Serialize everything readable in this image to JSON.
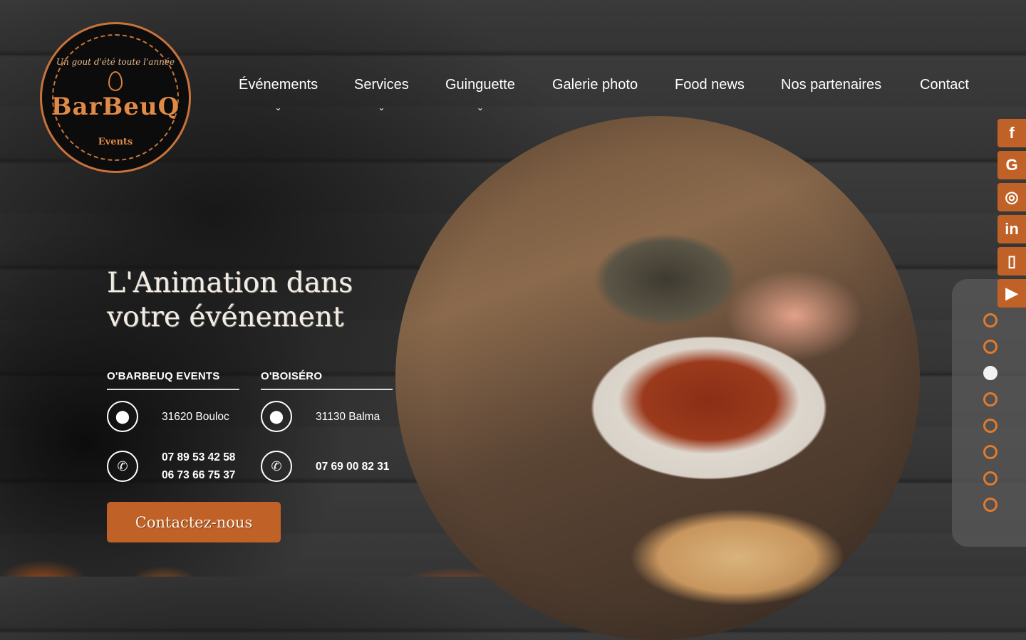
{
  "logo": {
    "tagline": "Un gout d'été toute l'année",
    "name": "BarBeuQ",
    "subtitle": "Events"
  },
  "nav": {
    "items": [
      {
        "label": "Événements",
        "has_dropdown": true
      },
      {
        "label": "Services",
        "has_dropdown": true
      },
      {
        "label": "Guinguette",
        "has_dropdown": true
      },
      {
        "label": "Galerie photo",
        "has_dropdown": false
      },
      {
        "label": "Food news",
        "has_dropdown": false
      },
      {
        "label": "Nos partenaires",
        "has_dropdown": false
      },
      {
        "label": "Contact",
        "has_dropdown": false
      }
    ]
  },
  "hero": {
    "title_line1": "L'Animation dans",
    "title_line2": "votre événement"
  },
  "locations": [
    {
      "name": "O'BARBEUQ EVENTS",
      "address": "31620 Bouloc",
      "phone1": "07 89 53 42 58",
      "phone2": "06 73 66 75 37"
    },
    {
      "name": "O'BOISÉRO",
      "address": "31130 Balma",
      "phone1": "07 69 00 82 31"
    }
  ],
  "cta": {
    "label": "Contactez-nous"
  },
  "social": [
    {
      "name": "facebook-icon",
      "glyph": "f"
    },
    {
      "name": "google-icon",
      "glyph": "G"
    },
    {
      "name": "instagram-icon",
      "glyph": "◎"
    },
    {
      "name": "linkedin-icon",
      "glyph": "in"
    },
    {
      "name": "mobile-icon",
      "glyph": "▯"
    },
    {
      "name": "youtube-icon",
      "glyph": "▶"
    }
  ],
  "slider": {
    "count": 8,
    "active_index": 2
  },
  "colors": {
    "accent": "#c06228",
    "dot_outline": "#e07a2e"
  }
}
